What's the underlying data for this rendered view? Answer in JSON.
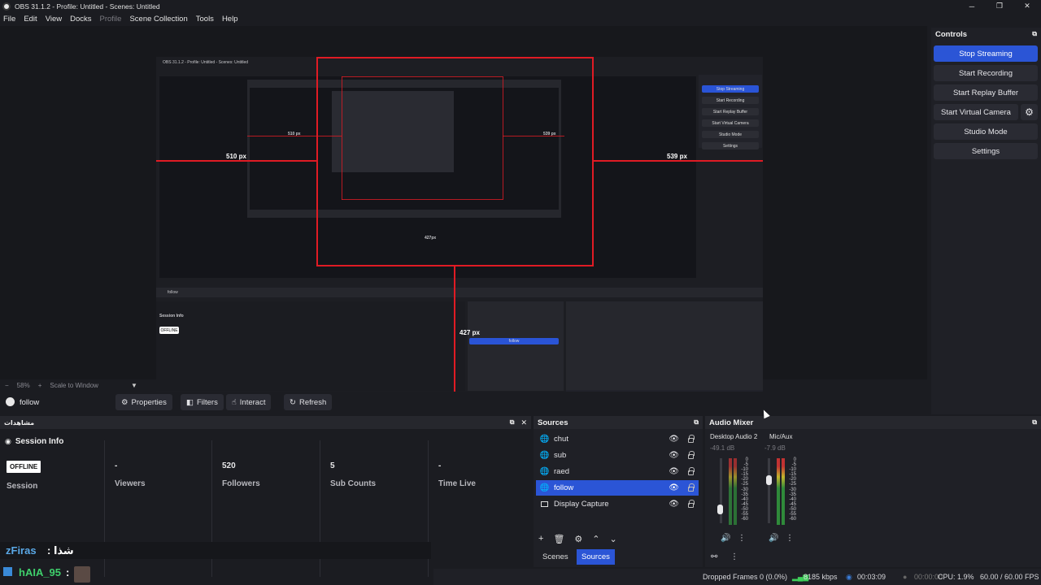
{
  "window": {
    "title": "OBS 31.1.2 - Profile: Untitled - Scenes: Untitled"
  },
  "menu": [
    "File",
    "Edit",
    "View",
    "Docks",
    "Profile",
    "Scene Collection",
    "Tools",
    "Help"
  ],
  "preview": {
    "measure_left": "510 px",
    "measure_right": "539 px",
    "measure_bottom": "427 px",
    "nested_measure_left": "510 px",
    "nested_measure_right": "539 px",
    "nested_measure_bottom": "427px",
    "nested_title": "OBS 31.1.2 - Profile: Untitled - Scenes: Untitled"
  },
  "controls": {
    "header": "Controls",
    "stop_streaming": "Stop Streaming",
    "start_recording": "Start Recording",
    "start_replay_buffer": "Start Replay Buffer",
    "start_virtual_camera": "Start Virtual Camera",
    "studio_mode": "Studio Mode",
    "settings": "Settings"
  },
  "zoom": {
    "minus": "−",
    "value": "58%",
    "plus": "+",
    "mode": "Scale to Window"
  },
  "source_toolbar": {
    "selected_source": "follow",
    "properties": "Properties",
    "filters": "Filters",
    "interact": "Interact",
    "refresh": "Refresh"
  },
  "arabic_dock": {
    "title": "مشاهدات",
    "session_info": "Session Info",
    "offline_badge": "OFFLINE",
    "session_label": "Session",
    "stats": [
      {
        "value": "-",
        "label": "Viewers"
      },
      {
        "value": "520",
        "label": "Followers"
      },
      {
        "value": "5",
        "label": "Sub Counts"
      },
      {
        "value": "-",
        "label": "Time Live"
      }
    ]
  },
  "chat": {
    "line1_user": "zFiras",
    "line1_text": ": شذا",
    "line2_user": "hAIA_95",
    "line2_text": ":"
  },
  "sources": {
    "title": "Sources",
    "items": [
      {
        "name": "chut",
        "selected": false
      },
      {
        "name": "sub",
        "selected": false
      },
      {
        "name": "raed",
        "selected": false
      },
      {
        "name": "follow",
        "selected": true
      },
      {
        "name": "Display Capture",
        "selected": false
      }
    ],
    "tab_scenes": "Scenes",
    "tab_sources": "Sources"
  },
  "mixer": {
    "title": "Audio Mixer",
    "channels": [
      {
        "name": "Desktop Audio 2",
        "db": "-49.1 dB"
      },
      {
        "name": "Mic/Aux",
        "db": "-7.9 dB"
      }
    ],
    "scale": [
      "0",
      "-5",
      "-10",
      "-15",
      "-20",
      "-25",
      "-30",
      "-35",
      "-40",
      "-45",
      "-50",
      "-55",
      "-60"
    ]
  },
  "status": {
    "dropped_frames": "Dropped Frames 0 (0.0%)",
    "bitrate": "8185 kbps",
    "stream_time": "00:03:09",
    "rec_time": "00:00:00",
    "cpu": "CPU: 1.9%",
    "fps": "60.00 / 60.00 FPS"
  },
  "colors": {
    "accent": "#2b55d6",
    "guide": "#e01b24",
    "bg": "#1b1c21"
  }
}
